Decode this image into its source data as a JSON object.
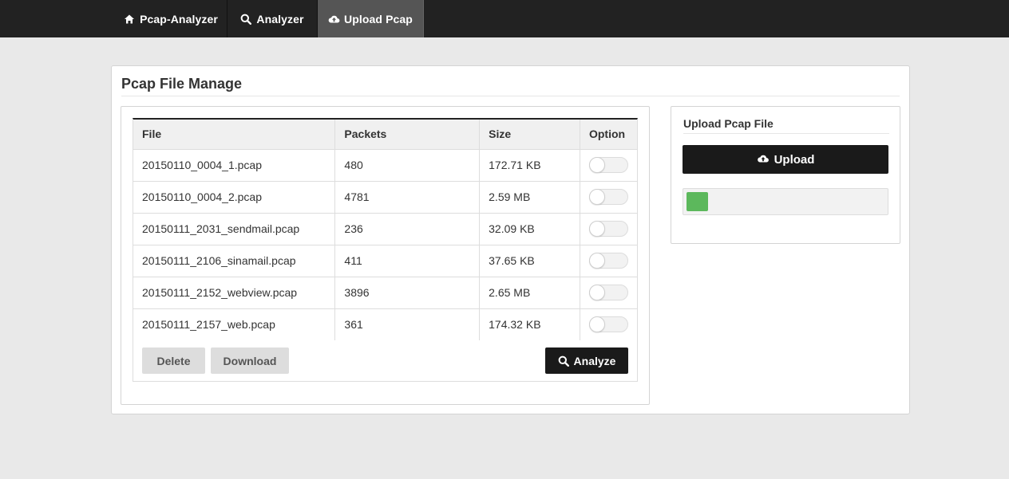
{
  "nav": {
    "items": [
      {
        "label": "Pcap-Analyzer",
        "icon": "home-icon",
        "active": false
      },
      {
        "label": "Analyzer",
        "icon": "search-icon",
        "active": false
      },
      {
        "label": "Upload Pcap",
        "icon": "cloud-upload-icon",
        "active": true
      }
    ]
  },
  "panel": {
    "title": "Pcap File Manage"
  },
  "table": {
    "headers": [
      "File",
      "Packets",
      "Size",
      "Option"
    ],
    "rows": [
      {
        "file": "20150110_0004_1.pcap",
        "packets": "480",
        "size": "172.71 KB",
        "selected": false
      },
      {
        "file": "20150110_0004_2.pcap",
        "packets": "4781",
        "size": "2.59 MB",
        "selected": false
      },
      {
        "file": "20150111_2031_sendmail.pcap",
        "packets": "236",
        "size": "32.09 KB",
        "selected": false
      },
      {
        "file": "20150111_2106_sinamail.pcap",
        "packets": "411",
        "size": "37.65 KB",
        "selected": false
      },
      {
        "file": "20150111_2152_webview.pcap",
        "packets": "3896",
        "size": "2.65 MB",
        "selected": false
      },
      {
        "file": "20150111_2157_web.pcap",
        "packets": "361",
        "size": "174.32 KB",
        "selected": false
      }
    ]
  },
  "actions": {
    "delete_label": "Delete",
    "download_label": "Download",
    "analyze_label": "Analyze"
  },
  "upload": {
    "title": "Upload Pcap File",
    "button_label": "Upload",
    "progress_fraction": 0.11,
    "progress_color": "#5cb85c"
  },
  "colors": {
    "navbar": "#222222",
    "nav_active": "#555555",
    "dark_button": "#1a1a1a",
    "page_background": "#e9e9e9"
  }
}
